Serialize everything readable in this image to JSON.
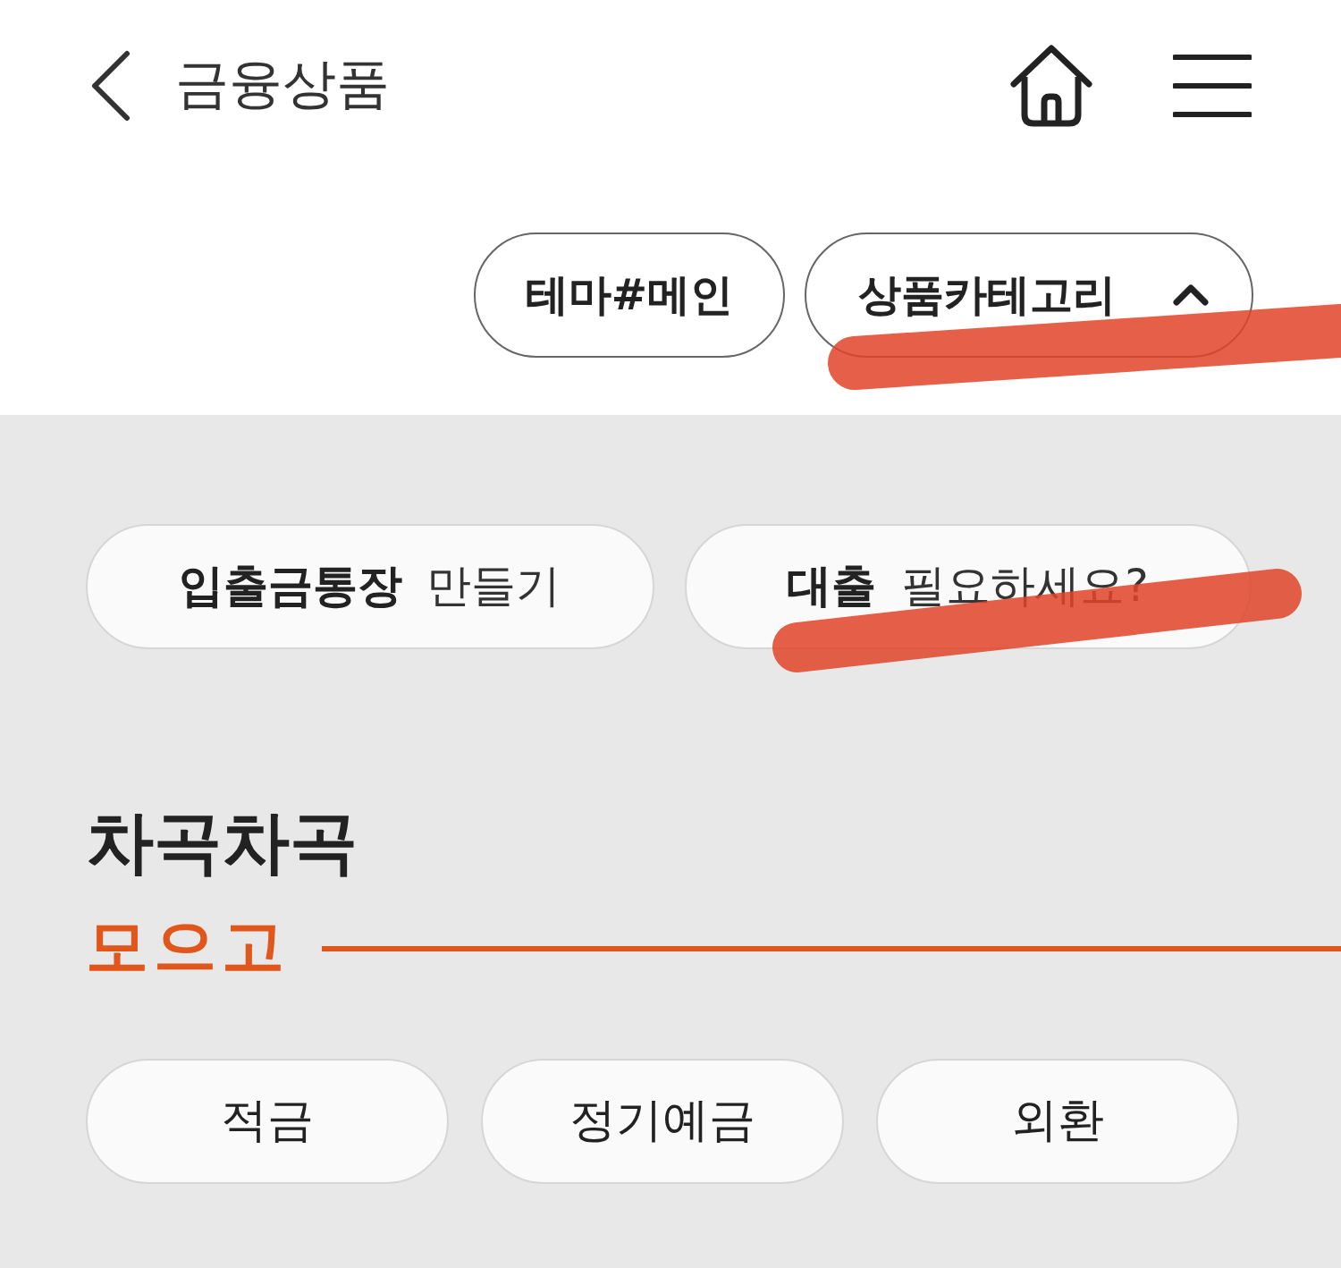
{
  "header": {
    "title": "금융상품"
  },
  "filter_buttons": [
    {
      "kind": "button",
      "label": "테마#메인"
    },
    {
      "kind": "dropdown",
      "label": "상품카테고리",
      "expanded": true
    }
  ],
  "quick_links": [
    {
      "label": "**입출금통장** 만들기"
    },
    {
      "label": "**대출** 필요하세요?"
    }
  ],
  "section": {
    "title": "차곡차곡",
    "subtitle": "모으고"
  },
  "categories": [
    {
      "label": "적금"
    },
    {
      "label": "정기예금"
    },
    {
      "label": "외환"
    }
  ]
}
